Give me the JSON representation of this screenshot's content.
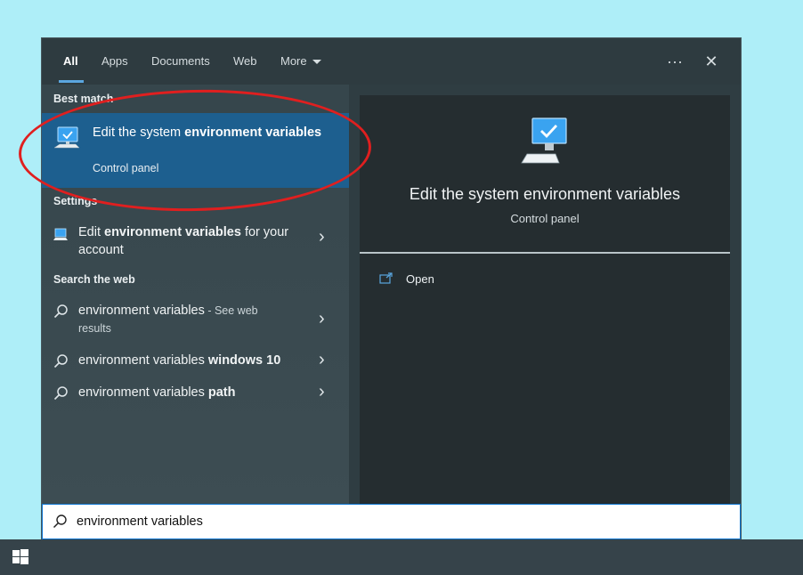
{
  "tabs": [
    {
      "label": "All",
      "active": true
    },
    {
      "label": "Apps"
    },
    {
      "label": "Documents"
    },
    {
      "label": "Web"
    },
    {
      "label": "More"
    }
  ],
  "top_controls": {
    "more_options_icon": "ellipsis-icon",
    "close_icon": "close-icon",
    "ellipsis": "···",
    "close": "✕"
  },
  "left": {
    "best_match_title": "Best match",
    "best_match": {
      "title_prefix": "Edit the system ",
      "title_bold": "environment variables",
      "subtitle": "Control panel",
      "icon": "monitor-settings-icon"
    },
    "settings_title": "Settings",
    "settings_item": {
      "prefix": "Edit ",
      "bold": "environment variables",
      "suffix": " for your account",
      "icon": "settings-monitor-icon"
    },
    "web_title": "Search the web",
    "web_items": [
      {
        "main": "environment variables",
        "bold": "",
        "muted": " - See web results"
      },
      {
        "main": "environment variables ",
        "bold": "windows 10",
        "muted": ""
      },
      {
        "main": "environment variables ",
        "bold": "path",
        "muted": ""
      }
    ]
  },
  "right": {
    "icon": "monitor-settings-icon",
    "title": "Edit the system environment variables",
    "subtitle": "Control panel",
    "action_open": "Open",
    "action_icon": "open-external-icon"
  },
  "search": {
    "value": "environment variables",
    "icon": "search-icon"
  },
  "taskbar": {
    "start_icon": "windows-logo-icon"
  },
  "colors": {
    "accent": "#1d5f8f",
    "annotation_ellipse": "#e01f1f",
    "desktop": "#aeeef8"
  }
}
